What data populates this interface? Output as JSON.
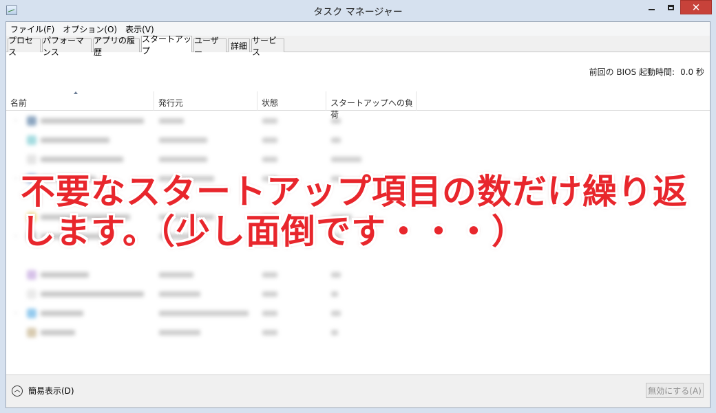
{
  "window": {
    "title": "タスク マネージャー"
  },
  "menubar": [
    "ファイル(F)",
    "オプション(O)",
    "表示(V)"
  ],
  "tabs": [
    "プロセス",
    "パフォーマンス",
    "アプリの履歴",
    "スタートアップ",
    "ユーザー",
    "詳細",
    "サービス"
  ],
  "active_tab": "スタートアップ",
  "bios": {
    "label": "前回の BIOS 起動時間:",
    "value": "0.0 秒"
  },
  "columns": {
    "name": "名前",
    "publisher": "発行元",
    "status": "状態",
    "impact": "スタートアップへの負荷"
  },
  "overlay": {
    "line1": "不要なスタートアップ項目の数だけ繰り返",
    "line2": "します。（少し面倒です・・・）"
  },
  "footer": {
    "fewer_details": "簡易表示(D)",
    "disable_button": "無効にする(A)"
  },
  "colors": {
    "overlay_text": "#e8262c",
    "close_button": "#c7423a"
  }
}
